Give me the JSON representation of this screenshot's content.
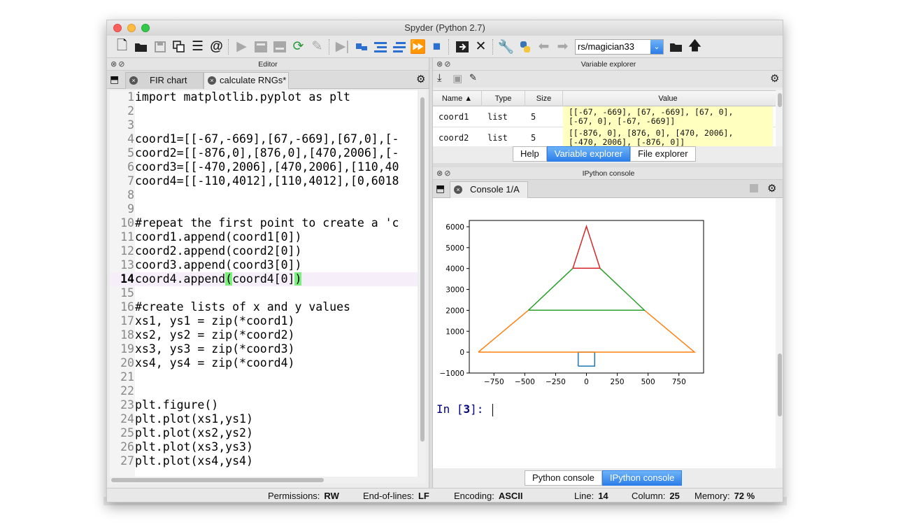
{
  "window": {
    "title": "Spyder (Python 2.7)",
    "path_value": "rs/magician33"
  },
  "editor_pane": {
    "title": "Editor",
    "tabs": [
      {
        "label": "FIR chart",
        "active": false
      },
      {
        "label": "calculate RNGs*",
        "active": true
      }
    ],
    "current_line": 14,
    "lines": [
      {
        "n": "1",
        "text": "import matplotlib.pyplot as plt"
      },
      {
        "n": "2",
        "text": ""
      },
      {
        "n": "3",
        "text": ""
      },
      {
        "n": "4",
        "text": "coord1=[[-67,-669],[67,-669],[67,0],[-"
      },
      {
        "n": "5",
        "text": "coord2=[[-876,0],[876,0],[470,2006],[-"
      },
      {
        "n": "6",
        "text": "coord3=[[-470,2006],[470,2006],[110,40"
      },
      {
        "n": "7",
        "text": "coord4=[[-110,4012],[110,4012],[0,6018"
      },
      {
        "n": "8",
        "text": ""
      },
      {
        "n": "9",
        "text": ""
      },
      {
        "n": "10",
        "text": "#repeat the first point to create a 'c"
      },
      {
        "n": "11",
        "text": "coord1.append(coord1[0])"
      },
      {
        "n": "12",
        "text": "coord2.append(coord2[0])"
      },
      {
        "n": "13",
        "text": "coord3.append(coord3[0])"
      },
      {
        "n": "14",
        "text": "coord4.append(coord4[0])"
      },
      {
        "n": "15",
        "text": ""
      },
      {
        "n": "16",
        "text": "#create lists of x and y values"
      },
      {
        "n": "17",
        "text": "xs1, ys1 = zip(*coord1)"
      },
      {
        "n": "18",
        "text": "xs2, ys2 = zip(*coord2)"
      },
      {
        "n": "19",
        "text": "xs3, ys3 = zip(*coord3)"
      },
      {
        "n": "20",
        "text": "xs4, ys4 = zip(*coord4)"
      },
      {
        "n": "21",
        "text": ""
      },
      {
        "n": "22",
        "text": ""
      },
      {
        "n": "23",
        "text": "plt.figure()"
      },
      {
        "n": "24",
        "text": "plt.plot(xs1,ys1)"
      },
      {
        "n": "25",
        "text": "plt.plot(xs2,ys2)"
      },
      {
        "n": "26",
        "text": "plt.plot(xs3,ys3)"
      },
      {
        "n": "27",
        "text": "plt.plot(xs4,ys4)"
      }
    ]
  },
  "variable_explorer": {
    "title": "Variable explorer",
    "columns": [
      "Name",
      "Type",
      "Size",
      "Value"
    ],
    "sort_marker": "▲",
    "rows": [
      {
        "name": "coord1",
        "type": "list",
        "size": "5",
        "value_line1": "[[-67, -669], [67, -669], [67, 0],",
        "value_line2": "[-67, 0], [-67, -669]]"
      },
      {
        "name": "coord2",
        "type": "list",
        "size": "5",
        "value_line1": "[[-876, 0], [876, 0], [470, 2006],",
        "value_line2": "[-470, 2006], [-876, 0]]"
      }
    ],
    "bottom_tabs": [
      "Help",
      "Variable explorer",
      "File explorer"
    ],
    "active_tab": "Variable explorer"
  },
  "ipython_console": {
    "title": "IPython console",
    "tab_label": "Console 1/A",
    "prompt_prefix": "In [",
    "prompt_number": "3",
    "prompt_suffix": "]:",
    "bottom_tabs": [
      "Python console",
      "IPython console"
    ],
    "active_tab": "IPython console"
  },
  "status_bar": {
    "permissions_label": "Permissions:",
    "permissions_value": "RW",
    "eol_label": "End-of-lines:",
    "eol_value": "LF",
    "encoding_label": "Encoding:",
    "encoding_value": "ASCII",
    "line_label": "Line:",
    "line_value": "14",
    "column_label": "Column:",
    "column_value": "25",
    "memory_label": "Memory:",
    "memory_value": "72 %"
  },
  "chart_data": {
    "type": "line",
    "title": "",
    "xlabel": "",
    "ylabel": "",
    "xlim": [
      -950,
      950
    ],
    "ylim": [
      -1000,
      6300
    ],
    "xticks": [
      -750,
      -500,
      -250,
      0,
      250,
      500,
      750
    ],
    "yticks": [
      -1000,
      0,
      1000,
      2000,
      3000,
      4000,
      5000,
      6000
    ],
    "grid": false,
    "series": [
      {
        "color": "#1f77b4",
        "points": [
          [
            -67,
            -669
          ],
          [
            67,
            -669
          ],
          [
            67,
            0
          ],
          [
            -67,
            0
          ],
          [
            -67,
            -669
          ]
        ]
      },
      {
        "color": "#ff7f0e",
        "points": [
          [
            -876,
            0
          ],
          [
            876,
            0
          ],
          [
            470,
            2006
          ],
          [
            -470,
            2006
          ],
          [
            -876,
            0
          ]
        ]
      },
      {
        "color": "#2ca02c",
        "points": [
          [
            -470,
            2006
          ],
          [
            470,
            2006
          ],
          [
            110,
            4012
          ],
          [
            -110,
            4012
          ],
          [
            -470,
            2006
          ]
        ]
      },
      {
        "color": "#d62728",
        "points": [
          [
            -110,
            4012
          ],
          [
            110,
            4012
          ],
          [
            0,
            6018
          ],
          [
            -110,
            4012
          ]
        ]
      }
    ]
  }
}
